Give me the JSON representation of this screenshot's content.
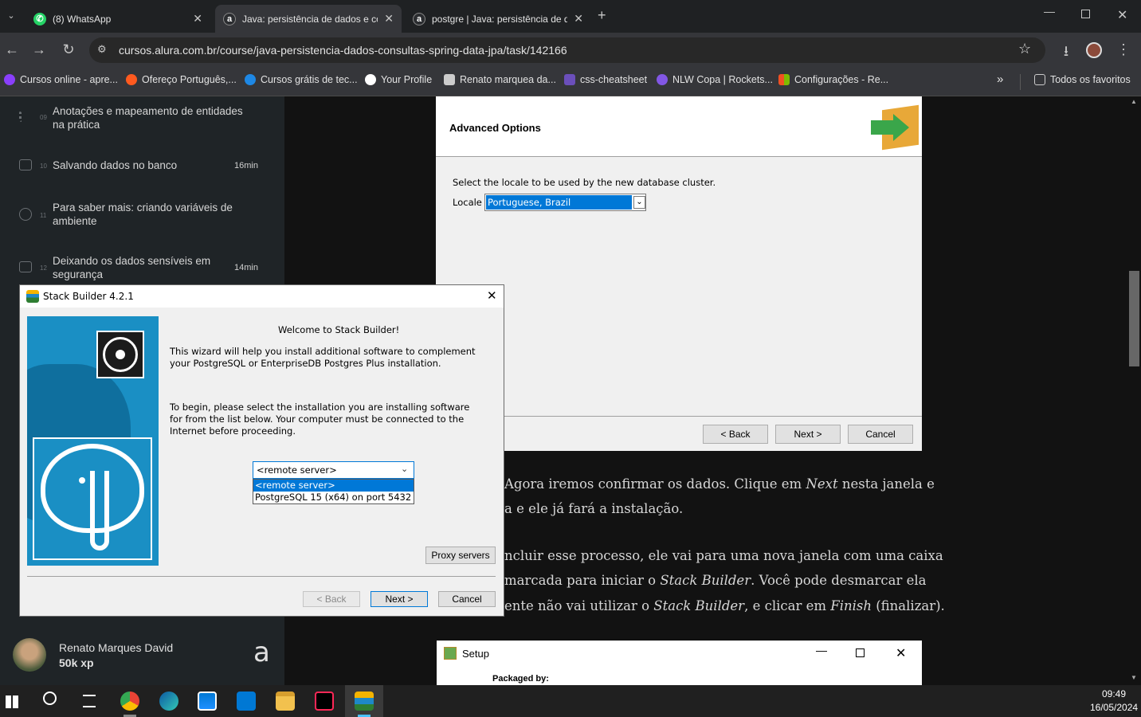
{
  "browser": {
    "tabs": [
      {
        "label": "(8) WhatsApp",
        "icon": "whatsapp-icon",
        "active": false
      },
      {
        "label": "Java: persistência de dados e co",
        "icon": "alura-icon",
        "active": true
      },
      {
        "label": "postgre | Java: persistência de d",
        "icon": "alura-icon",
        "active": false
      }
    ],
    "url": "cursos.alura.com.br/course/java-persistencia-dados-consultas-spring-data-jpa/task/142166",
    "bookmarks": [
      {
        "label": "Cursos online - apre...",
        "color": "#8a3ffc"
      },
      {
        "label": "Ofereço Português,...",
        "color": "#ff5a1f"
      },
      {
        "label": "Cursos grátis de tec...",
        "color": "#1e88e5"
      },
      {
        "label": "Your Profile",
        "color": "#ffffff"
      },
      {
        "label": "Renato marquea da...",
        "color": "#cccccc"
      },
      {
        "label": "css-cheatsheet",
        "color": "#6b4fbb"
      },
      {
        "label": "NLW Copa | Rockets...",
        "color": "#8257e5"
      },
      {
        "label": "Configurações - Re...",
        "color": "#f25022"
      }
    ],
    "all_bookmarks": "Todos os favoritos"
  },
  "sidebar": {
    "lessons": [
      {
        "num": "09",
        "title": "Anotações e mapeamento de entidades na prática",
        "duration": ""
      },
      {
        "num": "10",
        "title": "Salvando dados no banco",
        "duration": "16min"
      },
      {
        "num": "11",
        "title": "Para saber mais: criando variáveis de ambiente",
        "duration": ""
      },
      {
        "num": "12",
        "title": "Deixando os dados sensíveis em segurança",
        "duration": "14min"
      }
    ],
    "user": {
      "name": "Renato Marques David",
      "xp": "50k xp",
      "logo": "a"
    }
  },
  "pg_installer": {
    "heading": "Advanced Options",
    "prompt": "Select the locale to be used by the new database cluster.",
    "locale_label": "Locale",
    "locale_value": "Portuguese, Brazil",
    "back": "< Back",
    "next": "Next >",
    "cancel": "Cancel"
  },
  "article": {
    "line1a": "Agora iremos confirmar os dados. Clique em ",
    "line1b": "Next",
    "line1c": " nesta janela e",
    "line2": "a e ele já fará a instalação.",
    "line3": "ncluir esse processo, ele vai para uma nova janela com uma caixa",
    "line4a": "marcada para iniciar o ",
    "line4b": "Stack Builder",
    "line4c": ". Você pode desmarcar ela",
    "line5a": "ente não vai utilizar o ",
    "line5b": "Stack Builder",
    "line5c": ", e clicar em ",
    "line5d": "Finish",
    "line5e": " (finalizar)."
  },
  "setup_window": {
    "title": "Setup",
    "packaged_by": "Packaged by:"
  },
  "stack_builder": {
    "title": "Stack Builder 4.2.1",
    "welcome": "Welcome to Stack Builder!",
    "para1": "This wizard will help you install additional software to complement your PostgreSQL or EnterpriseDB Postgres Plus installation.",
    "para2": "To begin, please select the installation you are installing software for from the list below. Your computer must be connected to the Internet before proceeding.",
    "select_value": "<remote server>",
    "options": [
      "<remote server>",
      "PostgreSQL 15 (x64) on port 5432"
    ],
    "proxy": "Proxy servers",
    "back": "< Back",
    "next": "Next >",
    "cancel": "Cancel"
  },
  "taskbar": {
    "time": "09:49",
    "date": "16/05/2024"
  }
}
